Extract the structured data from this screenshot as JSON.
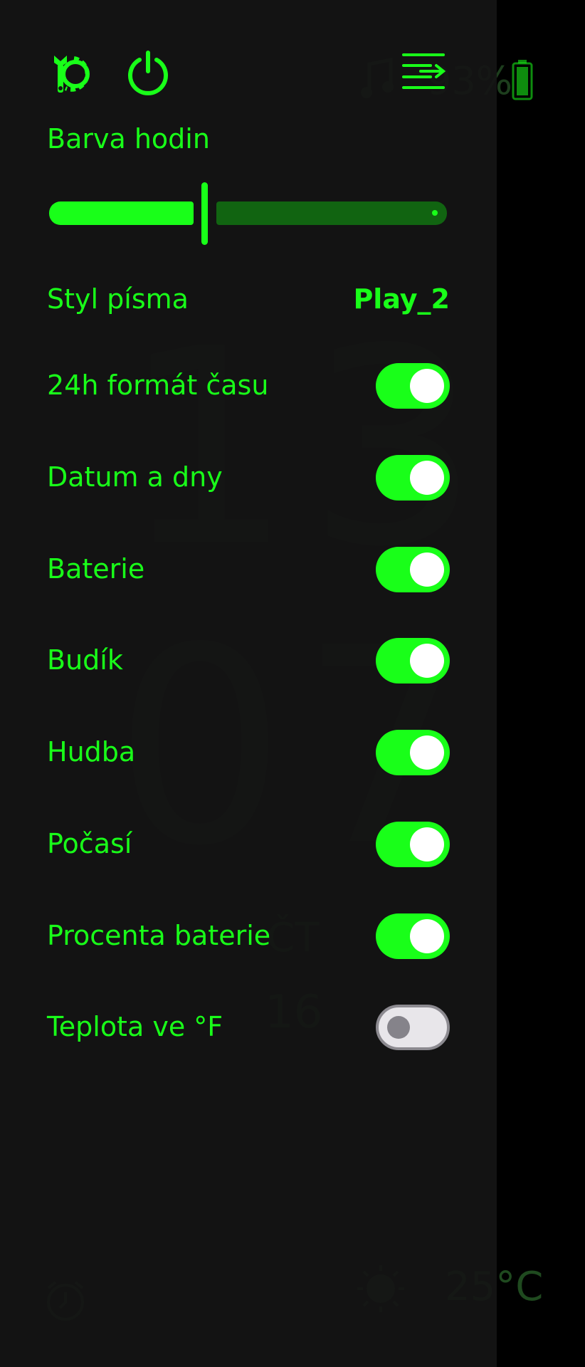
{
  "background": {
    "hours": "13",
    "minutes": "07",
    "day": "ČT",
    "date": "16",
    "battery_percent": "93%",
    "temperature": "25°C"
  },
  "topbar": {
    "settings_icon": "wrench-gear-icon",
    "power_icon": "power-icon",
    "menu_icon": "menu-arrow-icon"
  },
  "clock_color": {
    "label": "Barva hodin",
    "slider_value": 0.37
  },
  "font_style": {
    "label": "Styl písma",
    "value": "Play_2"
  },
  "toggles": [
    {
      "label": "24h formát času",
      "on": true
    },
    {
      "label": "Datum a dny",
      "on": true
    },
    {
      "label": "Baterie",
      "on": true
    },
    {
      "label": "Budík",
      "on": true
    },
    {
      "label": "Hudba",
      "on": true
    },
    {
      "label": "Počasí",
      "on": true
    },
    {
      "label": "Procenta baterie",
      "on": true
    },
    {
      "label": "Teplota ve °F",
      "on": false
    }
  ],
  "colors": {
    "accent": "#19ff19",
    "track_dark": "#116411",
    "panel": "#141414"
  }
}
